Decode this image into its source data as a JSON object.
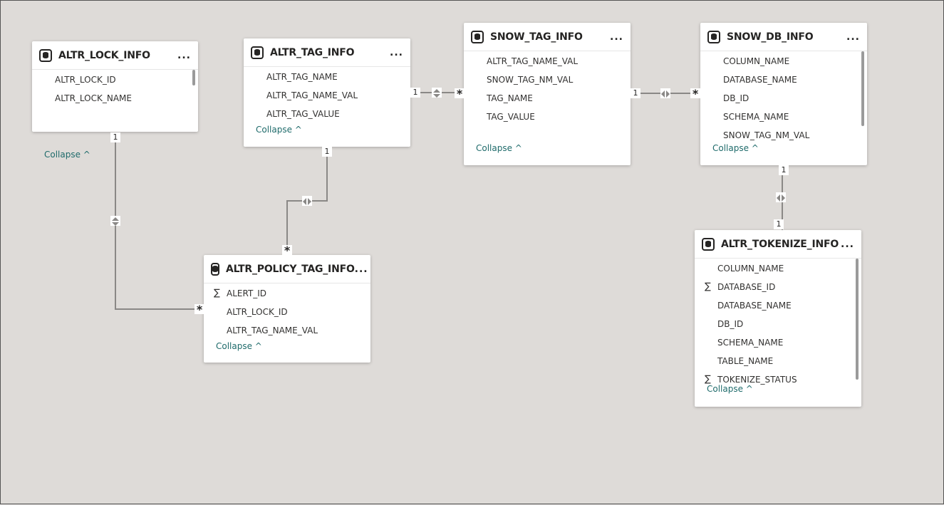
{
  "tables": [
    {
      "id": "lock",
      "title": "ALTR_LOCK_INFO",
      "icon": "table-icon",
      "fields": [
        {
          "name": "ALTR_LOCK_ID"
        },
        {
          "name": "ALTR_LOCK_NAME"
        }
      ],
      "collapse": "Collapse ^",
      "scrollbar": true
    },
    {
      "id": "tag",
      "title": "ALTR_TAG_INFO",
      "icon": "table-icon",
      "fields": [
        {
          "name": "ALTR_TAG_NAME"
        },
        {
          "name": "ALTR_TAG_NAME_VAL"
        },
        {
          "name": "ALTR_TAG_VALUE"
        }
      ],
      "collapse": "Collapse ^",
      "scrollbar": false
    },
    {
      "id": "snowtag",
      "title": "SNOW_TAG_INFO",
      "icon": "table-icon",
      "fields": [
        {
          "name": "ALTR_TAG_NAME_VAL"
        },
        {
          "name": "SNOW_TAG_NM_VAL"
        },
        {
          "name": "TAG_NAME"
        },
        {
          "name": "TAG_VALUE"
        }
      ],
      "collapse": "Collapse ^",
      "scrollbar": false
    },
    {
      "id": "snowdb",
      "title": "SNOW_DB_INFO",
      "icon": "table-icon",
      "fields": [
        {
          "name": "COLUMN_NAME"
        },
        {
          "name": "DATABASE_NAME"
        },
        {
          "name": "DB_ID"
        },
        {
          "name": "SCHEMA_NAME"
        },
        {
          "name": "SNOW_TAG_NM_VAL"
        }
      ],
      "collapse": "Collapse ^",
      "scrollbar": true
    },
    {
      "id": "policy",
      "title": "ALTR_POLICY_TAG_INFO",
      "icon": "table-icon",
      "fields": [
        {
          "name": "ALERT_ID",
          "sum": true
        },
        {
          "name": "ALTR_LOCK_ID"
        },
        {
          "name": "ALTR_TAG_NAME_VAL"
        }
      ],
      "collapse": "Collapse ^",
      "scrollbar": false
    },
    {
      "id": "tokenize",
      "title": "ALTR_TOKENIZE_INFO",
      "icon": "table-icon",
      "fields": [
        {
          "name": "COLUMN_NAME"
        },
        {
          "name": "DATABASE_ID",
          "sum": true
        },
        {
          "name": "DATABASE_NAME"
        },
        {
          "name": "DB_ID"
        },
        {
          "name": "SCHEMA_NAME"
        },
        {
          "name": "TABLE_NAME"
        },
        {
          "name": "TOKENIZE_STATUS",
          "sum": true
        }
      ],
      "collapse": "Collapse ^",
      "scrollbar": true
    }
  ],
  "more_label": "...",
  "sum_symbol": "∑",
  "relationships": [
    {
      "from": "lock",
      "to": "policy",
      "from_card": "1",
      "to_card": "*",
      "direction": "both"
    },
    {
      "from": "tag",
      "to": "policy",
      "from_card": "1",
      "to_card": "*",
      "direction": "both"
    },
    {
      "from": "tag",
      "to": "snowtag",
      "from_card": "1",
      "to_card": "*",
      "direction": "both"
    },
    {
      "from": "snowtag",
      "to": "snowdb",
      "from_card": "1",
      "to_card": "*",
      "direction": "both"
    },
    {
      "from": "snowdb",
      "to": "tokenize",
      "from_card": "1",
      "to_card": "1",
      "direction": "both"
    }
  ]
}
